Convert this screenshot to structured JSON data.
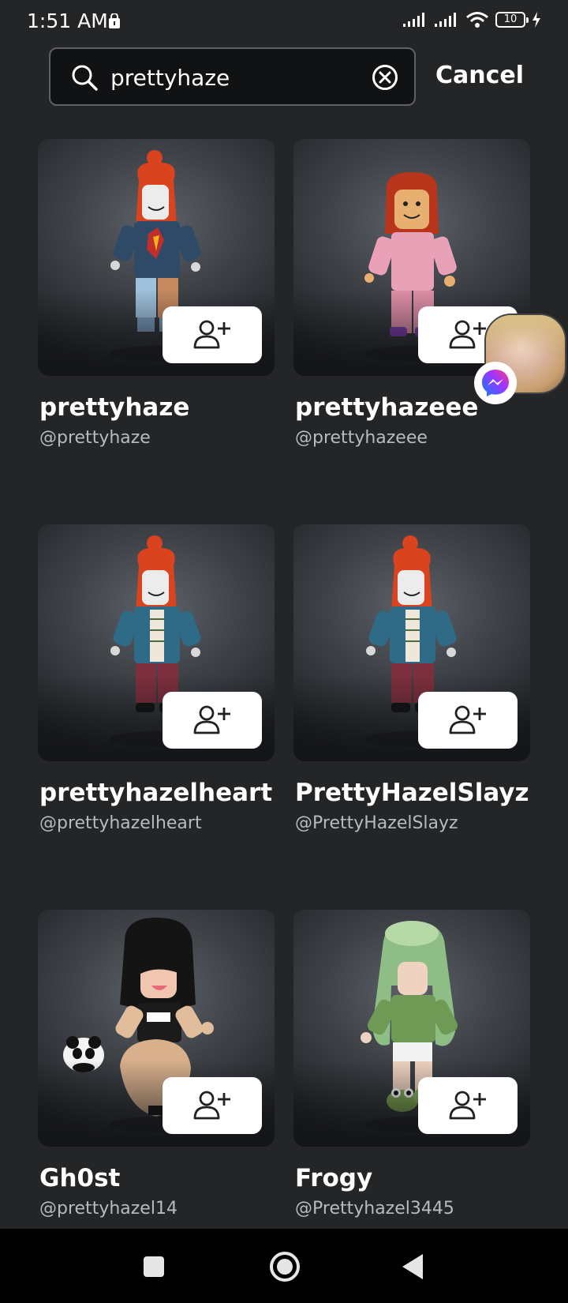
{
  "status_bar": {
    "time": "1:51 AM",
    "battery": "10"
  },
  "search": {
    "query": "prettyhaze",
    "cancel_label": "Cancel"
  },
  "results": [
    {
      "display_name": "prettyhaze",
      "username": "@prettyhaze",
      "avatar": "red-hair-pumpkin-sweater"
    },
    {
      "display_name": "prettyhazeee",
      "username": "@prettyhazeee",
      "avatar": "red-hair-pink-pajamas"
    },
    {
      "display_name": "prettyhazelheart",
      "username": "@prettyhazelheart",
      "avatar": "red-hair-teal-jacket"
    },
    {
      "display_name": "PrettyHazelSlayz",
      "username": "@PrettyHazelSlayz",
      "avatar": "red-hair-teal-jacket"
    },
    {
      "display_name": "Gh0st",
      "username": "@prettyhazel14",
      "avatar": "black-hair-panda"
    },
    {
      "display_name": "Frogy",
      "username": "@Prettyhazel3445",
      "avatar": "green-hair-frog"
    }
  ],
  "icons": {
    "search": "search-icon",
    "clear": "clear-icon",
    "add_friend": "add-friend-icon",
    "messenger": "messenger-icon",
    "nav_recents": "square-icon",
    "nav_home": "circle-icon",
    "nav_back": "triangle-back-icon"
  },
  "colors": {
    "background": "#232527",
    "secondary_text": "#b8babc",
    "messenger_gradient_start": "#0a7cff",
    "messenger_gradient_end": "#ff3f7a"
  }
}
